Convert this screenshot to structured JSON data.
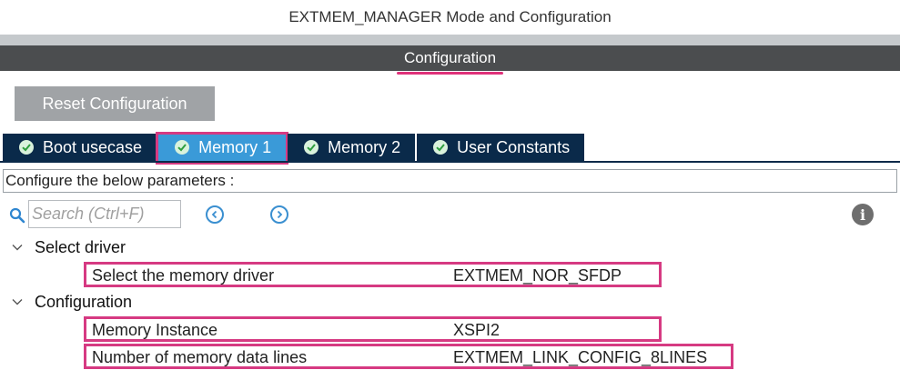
{
  "header": {
    "title": "EXTMEM_MANAGER Mode and Configuration",
    "config_label": "Configuration"
  },
  "toolbar": {
    "reset_label": "Reset Configuration"
  },
  "tabs": [
    {
      "label": "Boot usecase",
      "active": false
    },
    {
      "label": "Memory 1",
      "active": true
    },
    {
      "label": "Memory 2",
      "active": false
    },
    {
      "label": "User Constants",
      "active": false
    }
  ],
  "params": {
    "prompt": "Configure the below parameters :"
  },
  "search": {
    "placeholder": "Search (Ctrl+F)"
  },
  "icons": {
    "search": "search-icon",
    "prev": "arrow-left-circle-icon",
    "next": "arrow-right-circle-icon",
    "info": "info-icon",
    "check": "check-circle-icon",
    "chevron": "chevron-down-icon"
  },
  "colors": {
    "tab_bg": "#0a2a4a",
    "tab_active_bg": "#3a9ad8",
    "highlight": "#d63a82",
    "config_bar": "#4b4d4f"
  },
  "sections": [
    {
      "title": "Select driver",
      "rows": [
        {
          "label": "Select the memory driver",
          "value": "EXTMEM_NOR_SFDP"
        }
      ]
    },
    {
      "title": "Configuration",
      "rows": [
        {
          "label": "Memory Instance",
          "value": "XSPI2"
        },
        {
          "label": "Number of memory data lines",
          "value": "EXTMEM_LINK_CONFIG_8LINES"
        }
      ]
    }
  ]
}
